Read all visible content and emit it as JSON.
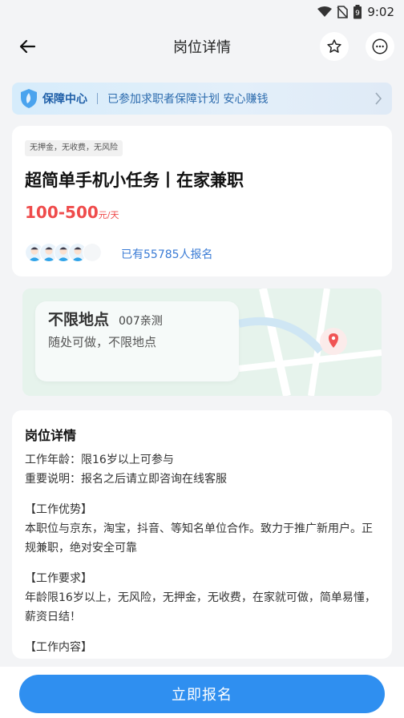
{
  "status": {
    "time": "9:02",
    "battery_text": "9"
  },
  "header": {
    "title": "岗位详情"
  },
  "banner": {
    "title": "保障中心",
    "text": "已参加求职者保障计划  安心赚钱"
  },
  "job": {
    "tag": "无押金，无收费，无风险",
    "title": "超简单手机小任务丨在家兼职",
    "salary_amount": "100-500",
    "salary_unit": "元/天",
    "applied_text": "已有55785人报名"
  },
  "location": {
    "title": "不限地点",
    "sub": "007亲测",
    "desc": "随处可做，不限地点"
  },
  "details": {
    "section_title": "岗位详情",
    "lines": [
      " 工作年龄：限16岁以上可参与",
      " 重要说明：报名之后请立即咨询在线客服",
      "",
      " 【工作优势】",
      "本职位与京东，淘宝，抖音、等知名单位合作。致力于推广新用户。正规兼职，绝对安全可靠",
      "",
      " 【工作要求】",
      "年龄限16岁以上，无风险，无押金，无收费，在家就可做，简单易懂，薪资日结！",
      "",
      " 【工作内容】"
    ]
  },
  "footer": {
    "apply_label": "立即报名"
  },
  "colors": {
    "accent": "#2f8ff0",
    "salary": "#ef4b4b",
    "link": "#3a7bd5"
  }
}
